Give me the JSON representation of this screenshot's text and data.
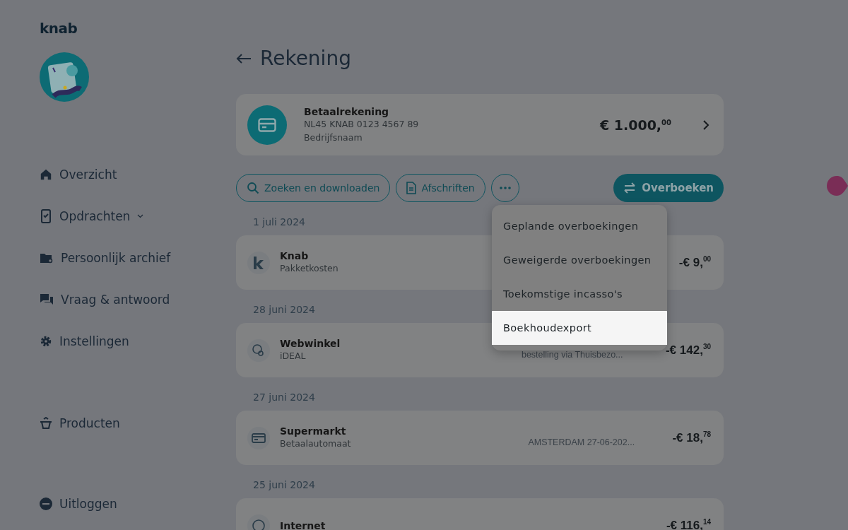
{
  "logo": "knab",
  "sidebar": {
    "items": [
      {
        "label": "Overzicht",
        "expandable": false
      },
      {
        "label": "Opdrachten",
        "expandable": true
      },
      {
        "label": "Persoonlijk archief",
        "expandable": false
      },
      {
        "label": "Vraag & antwoord",
        "expandable": false
      },
      {
        "label": "Instellingen",
        "expandable": false
      }
    ],
    "products": {
      "label": "Producten"
    },
    "logout": {
      "label": "Uitloggen"
    }
  },
  "page_title": "Rekening",
  "account": {
    "name": "Betaalrekening",
    "iban": "NL45 KNAB 0123 4567 89",
    "holder": "Bedrijfsnaam",
    "balance": "€ 1.000,$^{00}$"
  },
  "actions": [
    {
      "label": "Zoeken en downloaden"
    },
    {
      "label": "Afschriften"
    }
  ],
  "primary_action": "Overboeken",
  "more_menu": {
    "items": [
      {
        "label": "Geplande overboekingen",
        "selected": false
      },
      {
        "label": "Geweigerde overboekingen",
        "selected": false
      },
      {
        "label": "Toekomstige incasso's",
        "selected": false
      },
      {
        "label": "Boekhoudexport",
        "selected": true
      }
    ]
  },
  "transaction_groups": [
    {
      "date": "1 juli 2024",
      "transactions": [
        {
          "kind": "logo",
          "name": "Knab",
          "type": "Pakketkosten",
          "amount": "-€ 9,$^{00}$"
        }
      ]
    },
    {
      "date": "28 juni 2024",
      "transactions": [
        {
          "kind": "ideal",
          "name": "Webwinkel",
          "type": "iDEAL",
          "description": "bestelling via Thuisbezo...",
          "amount": "-€ 142,$^{30}$"
        }
      ]
    },
    {
      "date": "27 juni 2024",
      "transactions": [
        {
          "kind": "card",
          "name": "Supermarkt",
          "type": "Betaalautomaat",
          "description": "AMSTERDAM 27-06-202...",
          "amount": "-€ 18,$^{78}$"
        }
      ]
    },
    {
      "date": "25 juni 2024",
      "transactions": [
        {
          "kind": "euro",
          "name": "Internet",
          "amount": "-€ 116,$^{14}$"
        }
      ]
    }
  ]
}
